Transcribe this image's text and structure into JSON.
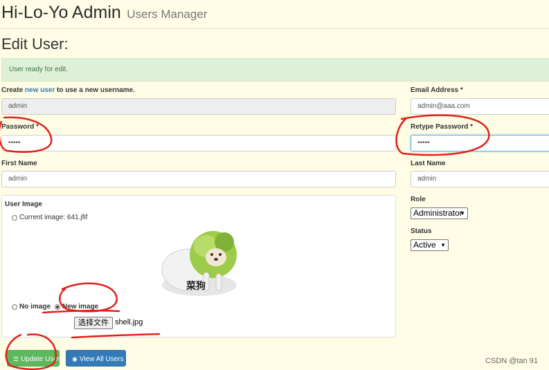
{
  "header": {
    "app_name": "Hi-Lo-Yo Admin",
    "section": "Users Manager"
  },
  "page_title": "Edit User:",
  "alert": {
    "message": "User ready for edit."
  },
  "form": {
    "username_hint": {
      "prefix": "Create ",
      "link": "new user",
      "suffix": " to use a new username."
    },
    "username_value": "admin",
    "email_label": "Email Address *",
    "email_value": "admin@aaa.com",
    "password_label": "Password *",
    "password_value": "•••••",
    "retype_label": "Retype Password *",
    "retype_value": "•••••",
    "first_name_label": "First Name",
    "first_name_value": "admin",
    "last_name_label": "Last Name",
    "last_name_value": "admin",
    "user_image": {
      "label": "User Image",
      "current_option": "Current image: 641.jfif",
      "image_caption": "菜狗",
      "no_image_option": "No image",
      "new_image_option": "New image",
      "selected": "new",
      "file_button": "选择文件",
      "file_name": "shell.jpg"
    },
    "role_label": "Role",
    "role_value": "Administrator",
    "status_label": "Status",
    "status_value": "Active"
  },
  "buttons": {
    "update": "Update User",
    "view_all": "View All Users"
  },
  "watermark": "CSDN @tan 91",
  "colors": {
    "background": "#fffde6",
    "alert_bg": "#dff0d8",
    "success": "#5cb85c",
    "primary": "#337ab7",
    "annotation": "#e0201a"
  },
  "icons": {
    "update": "database-icon",
    "view_all": "eye-icon"
  }
}
